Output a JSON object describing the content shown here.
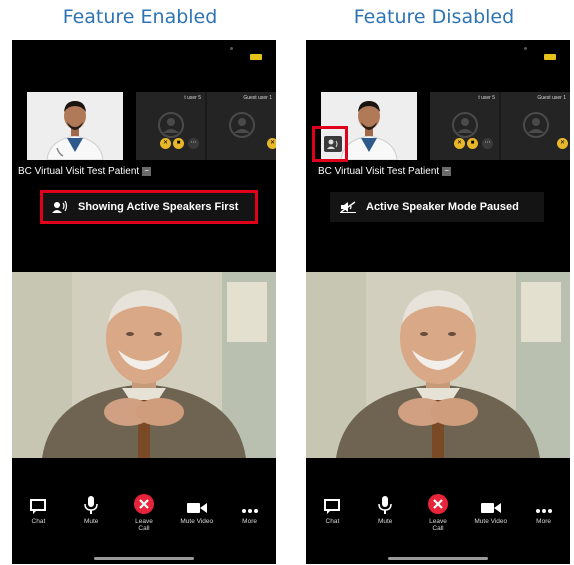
{
  "captions": {
    "left": "Feature Enabled",
    "right": "Feature Disabled"
  },
  "colors": {
    "caption": "#2e74b5",
    "highlight": "#e0001b",
    "phone_bg": "#000000",
    "leave": "#e8243a",
    "badge": "#e8b82a"
  },
  "panels": {
    "enabled": {
      "patient_name": "BC Virtual Visit Test Patient",
      "banner_text": "Showing Active Speakers First",
      "banner_icon": "active-speaker-icon",
      "participants": [
        {
          "name": "t user 5"
        },
        {
          "name": "Guest user 1"
        }
      ]
    },
    "disabled": {
      "patient_name": "BC Virtual Visit Test Patient",
      "banner_text": "Active Speaker Mode Paused",
      "banner_icon": "speaker-paused-icon",
      "participants": [
        {
          "name": "t user 5"
        },
        {
          "name": "Guest user 1"
        }
      ]
    }
  },
  "toolbar": {
    "chat": "Chat",
    "mute": "Mute",
    "leave_line1": "Leave",
    "leave_line2": "Call",
    "mute_video": "Mute Video",
    "more": "More"
  }
}
